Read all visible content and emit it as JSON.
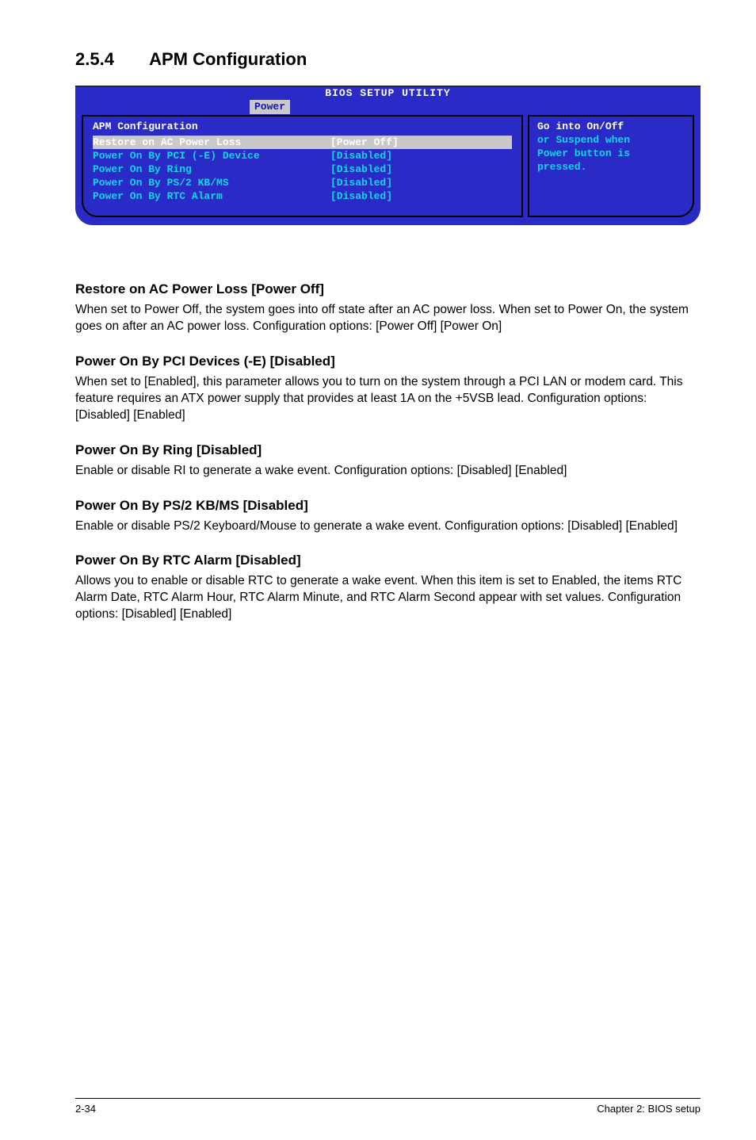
{
  "heading": {
    "number": "2.5.4",
    "title": "APM Configuration"
  },
  "bios": {
    "header": "BIOS SETUP UTILITY",
    "tab": "Power",
    "section_title": "APM Configuration",
    "rows": [
      {
        "key": "Restore on AC Power Loss",
        "val": "[Power Off]",
        "hl": true
      },
      {
        "key": "",
        "val": "",
        "hl": false
      },
      {
        "key": "Power On By PCI (-E) Device",
        "val": "[Disabled]",
        "hl": false
      },
      {
        "key": "Power On By Ring",
        "val": "[Disabled]",
        "hl": false
      },
      {
        "key": "Power On By PS/2 KB/MS",
        "val": "[Disabled]",
        "hl": false
      },
      {
        "key": "Power On By RTC Alarm",
        "val": "[Disabled]",
        "hl": false
      }
    ],
    "help_l1": "Go into On/Off",
    "help_l2": "or Suspend when",
    "help_l3": "Power button is",
    "help_l4": "pressed."
  },
  "sections": {
    "s1": {
      "h": "Restore on AC Power Loss [Power Off]",
      "p": "When set to Power Off, the system goes into off state after an AC power loss. When set to Power On, the system goes on after an AC power loss. Configuration options: [Power Off] [Power On]"
    },
    "s2": {
      "h": "Power On By PCI Devices (-E) [Disabled]",
      "p": "When set to [Enabled], this parameter allows you to turn on the system through a PCI LAN or modem card. This feature requires an ATX power supply that provides at least 1A on the +5VSB lead. Configuration options: [Disabled] [Enabled]"
    },
    "s3": {
      "h": "Power On By Ring [Disabled]",
      "p": "Enable or disable RI to generate a wake event. Configuration options: [Disabled] [Enabled]"
    },
    "s4": {
      "h": "Power On By PS/2 KB/MS [Disabled]",
      "p": "Enable or disable PS/2 Keyboard/Mouse to generate a wake event. Configuration options: [Disabled] [Enabled]"
    },
    "s5": {
      "h": "Power On By RTC Alarm [Disabled]",
      "p": "Allows you to enable or disable RTC to generate a wake event. When this item is set to Enabled, the items RTC Alarm Date, RTC Alarm Hour, RTC Alarm Minute, and RTC Alarm Second appear with set values. Configuration options: [Disabled] [Enabled]"
    }
  },
  "footer": {
    "left": "2-34",
    "right": "Chapter 2: BIOS setup"
  }
}
